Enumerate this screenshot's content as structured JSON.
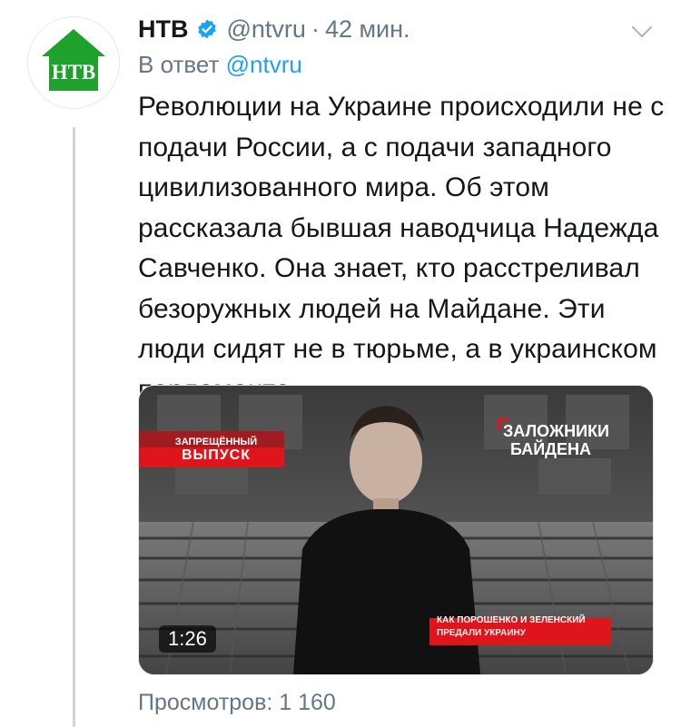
{
  "colors": {
    "brand_green": "#1fa12e",
    "link_blue": "#1da1f2",
    "verified_blue": "#1da1f2",
    "meta_gray": "#657786",
    "thread_line": "#ccd6dd",
    "badge_red": "#e0151b"
  },
  "tweet": {
    "author_name": "НТВ",
    "author_handle": "@ntvru",
    "separator": "·",
    "time_ago": "42 мин.",
    "reply_prefix": "В ответ",
    "reply_to": "@ntvru",
    "text": "Революции на Украине происходили не с подачи России, а с подачи западного цивилизованного мира. Об этом рассказала бывшая наводчица Надежда Савченко. Она знает, кто расстреливал безоружных людей на Майдане. Эти люди сидят не в тюрьме, а в украинском парламенте",
    "views": "Просмотров: 1 160"
  },
  "avatar": {
    "icon": "ntv-logo-icon",
    "logo_text": "НТВ"
  },
  "video": {
    "duration": "1:26",
    "badge_left_line1": "ЗАПРЕЩЁННЫЙ",
    "badge_left_line2": "ВЫПУСК",
    "badge_right_line1": "ЗАЛОЖНИКИ",
    "badge_right_line2": "БАЙДЕНА",
    "caption_line1": "КАК ПОРОШЕНКО И ЗЕЛЕНСКИЙ",
    "caption_line2": "ПРЕДАЛИ УКРАИНУ"
  }
}
